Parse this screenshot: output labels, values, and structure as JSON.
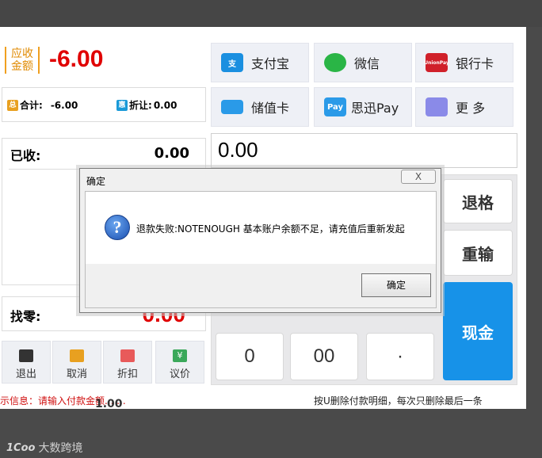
{
  "amount": {
    "label": "应收金额",
    "value": "-6.00"
  },
  "summary": {
    "total_badge": "总",
    "total_label": "合计:",
    "total_value": "-6.00",
    "discount_badge": "惠",
    "discount_label": "折让:",
    "discount_value": "0.00"
  },
  "received": {
    "label": "已收:",
    "value": "0.00"
  },
  "change": {
    "label": "找零:",
    "value": "0.00"
  },
  "actions": [
    {
      "label": "退出",
      "icon": "exit-icon",
      "color": "#333333"
    },
    {
      "label": "取消",
      "icon": "cancel-icon",
      "color": "#e8a020"
    },
    {
      "label": "折扣",
      "icon": "tag-icon",
      "color": "#e85a5a"
    },
    {
      "label": "议价",
      "icon": "yen-icon",
      "color": "#3aa85a"
    }
  ],
  "payments": [
    {
      "label": "支付宝",
      "icon": "alipay-icon",
      "color": "#1a8fe0",
      "icon_text": "支"
    },
    {
      "label": "微信",
      "icon": "wechat-icon",
      "color": "#2ab546",
      "icon_text": ""
    },
    {
      "label": "银行卡",
      "icon": "unionpay-icon",
      "color": "#d0202a",
      "icon_text": "UnionPay"
    },
    {
      "label": "储值卡",
      "icon": "stored-card-icon",
      "color": "#2a9ae8",
      "icon_text": ""
    },
    {
      "label": "思迅Pay",
      "icon": "pay-icon",
      "color": "#2a9ae8",
      "icon_text": "Pay"
    },
    {
      "label": "更 多",
      "icon": "more-icon",
      "color": "#8a8ae8",
      "icon_text": ""
    }
  ],
  "input": {
    "value": "0.00"
  },
  "keys": {
    "k0": "0",
    "k00": "00",
    "kdot": "·",
    "backspace": "退格",
    "reenter": "重输",
    "cash": "现金"
  },
  "status": {
    "left": "示信息：请输入付款金额... ...",
    "right": "按U删除付款明细，每次只删除最后一条"
  },
  "under_text": "1.00",
  "watermark": {
    "mark": "1Coo",
    "text": "大数跨境"
  },
  "dialog": {
    "title": "确定",
    "close": "X",
    "message": "退款失败:NOTENOUGH 基本账户余额不足，请充值后重新发起",
    "ok_label": "确定"
  }
}
